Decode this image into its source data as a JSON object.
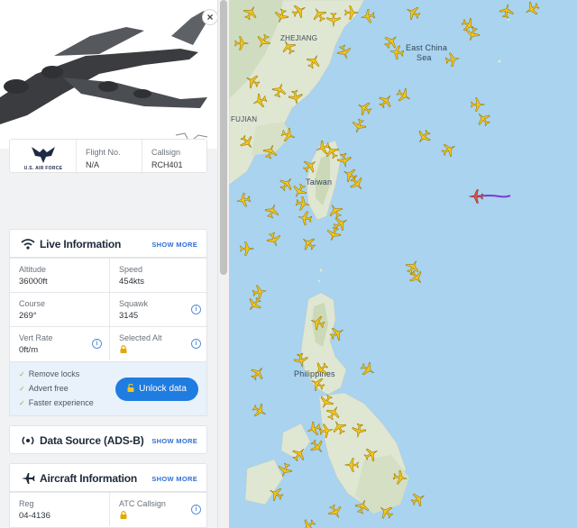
{
  "aircraft": {
    "operator_logo_text": "U.S. AIR FORCE",
    "flight_no_label": "Flight No.",
    "flight_no": "N/A",
    "callsign_label": "Callsign",
    "callsign": "RCH401"
  },
  "close_label": "×",
  "live": {
    "title": "Live Information",
    "show_more": "SHOW MORE",
    "altitude_label": "Altitude",
    "altitude": "36000ft",
    "speed_label": "Speed",
    "speed": "454kts",
    "course_label": "Course",
    "course": "269°",
    "squawk_label": "Squawk",
    "squawk": "3145",
    "vert_rate_label": "Vert Rate",
    "vert_rate": "0ft/m",
    "selected_alt_label": "Selected Alt"
  },
  "promo": {
    "features": [
      "Remove locks",
      "Advert free",
      "Faster experience"
    ],
    "button": "Unlock data"
  },
  "data_source": {
    "title": "Data Source (ADS-B)",
    "show_more": "SHOW MORE"
  },
  "aircraft_info": {
    "title": "Aircraft Information",
    "show_more": "SHOW MORE",
    "reg_label": "Reg",
    "reg": "04-4136",
    "atc_callsign_label": "ATC Callsign"
  },
  "map": {
    "labels": [
      "ZHEJIANG",
      "East China",
      "Sea",
      "FUJIAN",
      "Taiwan",
      "Philippines"
    ]
  },
  "colors": {
    "accent": "#1f7ce0",
    "plane": "#f5c518",
    "selected_plane": "#d9534f",
    "track": "#7a3bd6",
    "water": "#a9d3ee",
    "land": "#dfe7d3"
  }
}
